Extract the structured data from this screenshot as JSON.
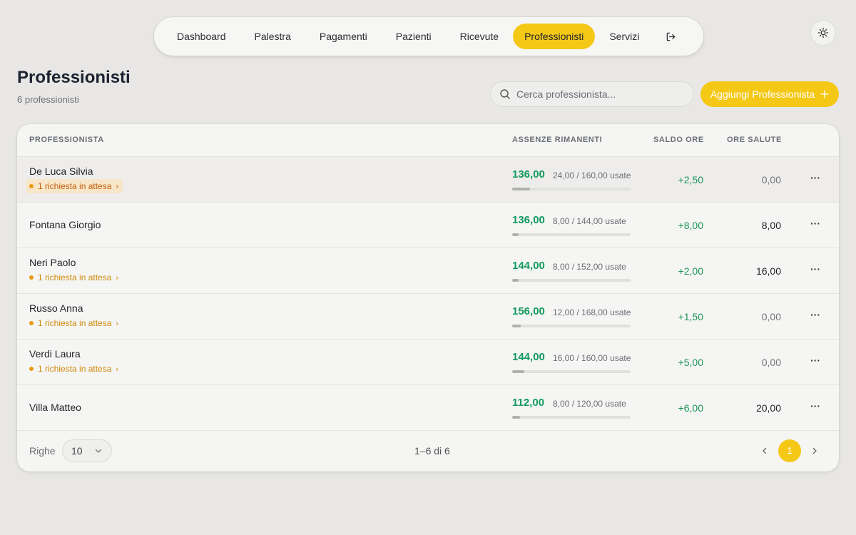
{
  "nav": {
    "items": [
      {
        "label": "Dashboard",
        "active": false
      },
      {
        "label": "Palestra",
        "active": false
      },
      {
        "label": "Pagamenti",
        "active": false
      },
      {
        "label": "Pazienti",
        "active": false
      },
      {
        "label": "Ricevute",
        "active": false
      },
      {
        "label": "Professionisti",
        "active": true
      },
      {
        "label": "Servizi",
        "active": false
      }
    ],
    "logout_icon": "logout-icon",
    "theme_icon": "sun-icon"
  },
  "header": {
    "title": "Professionisti",
    "subtitle": "6 professionisti"
  },
  "search": {
    "placeholder": "Cerca professionista...",
    "icon": "search-icon"
  },
  "add_button": {
    "label": "Aggiungi Professionista",
    "icon": "plus-icon"
  },
  "table": {
    "columns": {
      "professional": "PROFESSIONISTA",
      "absences": "ASSENZE RIMANENTI",
      "balance": "SALDO ORE",
      "health": "ORE SALUTE"
    },
    "rows": [
      {
        "name": "De Luca Silvia",
        "pending": "1 richiesta in attesa",
        "remaining": "136,00",
        "used": "24,00 / 160,00 usate",
        "used_fraction": 0.15,
        "balance": "+2,50",
        "health": "0,00",
        "highlight": true
      },
      {
        "name": "Fontana Giorgio",
        "pending": "",
        "remaining": "136,00",
        "used": "8,00 / 144,00 usate",
        "used_fraction": 0.056,
        "balance": "+8,00",
        "health": "8,00",
        "highlight": false
      },
      {
        "name": "Neri Paolo",
        "pending": "1 richiesta in attesa",
        "remaining": "144,00",
        "used": "8,00 / 152,00 usate",
        "used_fraction": 0.053,
        "balance": "+2,00",
        "health": "16,00",
        "highlight": false
      },
      {
        "name": "Russo Anna",
        "pending": "1 richiesta in attesa",
        "remaining": "156,00",
        "used": "12,00 / 168,00 usate",
        "used_fraction": 0.071,
        "balance": "+1,50",
        "health": "0,00",
        "highlight": false
      },
      {
        "name": "Verdi Laura",
        "pending": "1 richiesta in attesa",
        "remaining": "144,00",
        "used": "16,00 / 160,00 usate",
        "used_fraction": 0.1,
        "balance": "+5,00",
        "health": "0,00",
        "highlight": false
      },
      {
        "name": "Villa Matteo",
        "pending": "",
        "remaining": "112,00",
        "used": "8,00 / 120,00 usate",
        "used_fraction": 0.067,
        "balance": "+6,00",
        "health": "20,00",
        "highlight": false
      }
    ]
  },
  "footer": {
    "rows_label": "Righe",
    "rows_value": "10",
    "range": "1–6 di 6",
    "current_page": "1"
  },
  "colors": {
    "accent": "#f5c816",
    "positive": "#139a5f",
    "pending": "#e89a10"
  }
}
